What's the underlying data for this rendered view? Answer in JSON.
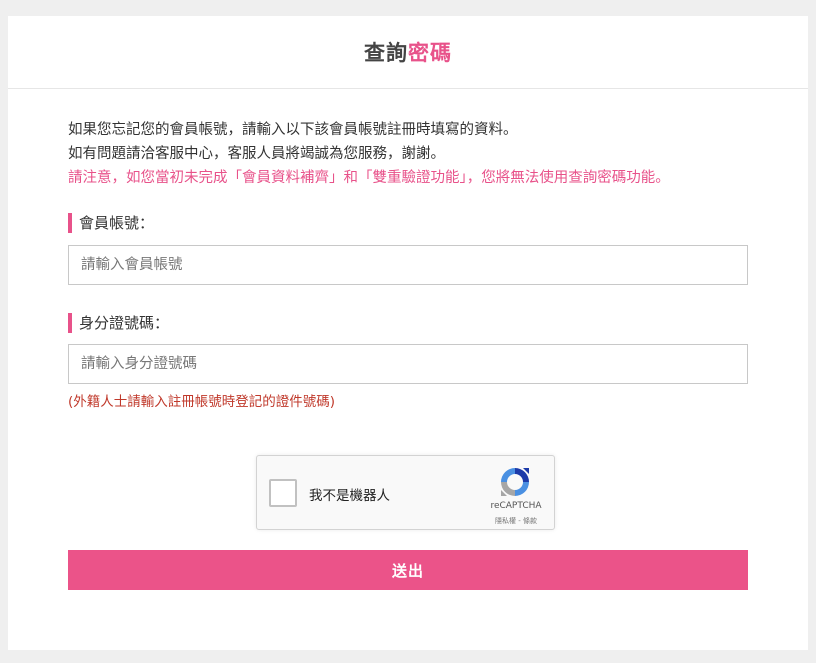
{
  "header": {
    "title_main": "查詢",
    "title_accent": "密碼"
  },
  "intro": {
    "line1": "如果您忘記您的會員帳號，請輸入以下該會員帳號註冊時填寫的資料。",
    "line2": "如有問題請洽客服中心，客服人員將竭誠為您服務，謝謝。",
    "warning": "請注意，如您當初未完成「會員資料補齊」和「雙重驗證功能」，您將無法使用查詢密碼功能。"
  },
  "form": {
    "account": {
      "label": "會員帳號：",
      "placeholder": "請輸入會員帳號",
      "value": ""
    },
    "id_number": {
      "label": "身分證號碼：",
      "placeholder": "請輸入身分證號碼",
      "value": "",
      "hint": "(外籍人士請輸入註冊帳號時登記的證件號碼)"
    }
  },
  "recaptcha": {
    "label": "我不是機器人",
    "brand": "reCAPTCHA",
    "terms": "隱私權 - 條款",
    "checked": false
  },
  "submit": {
    "label": "送出"
  },
  "colors": {
    "accent": "#e8528a",
    "button": "#eb5389",
    "hint": "#c0392b",
    "background": "#efefef"
  }
}
